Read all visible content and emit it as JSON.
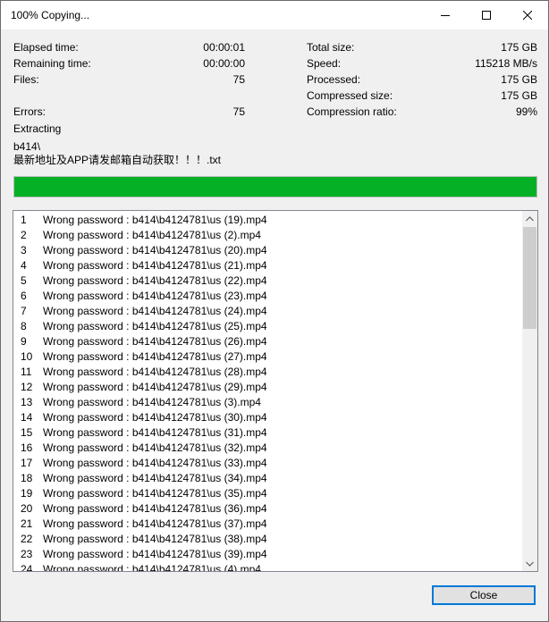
{
  "window": {
    "title": "100% Copying..."
  },
  "stats": {
    "elapsed_label": "Elapsed time:",
    "elapsed_value": "00:00:01",
    "remaining_label": "Remaining time:",
    "remaining_value": "00:00:00",
    "files_label": "Files:",
    "files_value": "75",
    "errors_label": "Errors:",
    "errors_value": "75",
    "total_size_label": "Total size:",
    "total_size_value": "175 GB",
    "speed_label": "Speed:",
    "speed_value": "115218 MB/s",
    "processed_label": "Processed:",
    "processed_value": "175 GB",
    "compressed_label": "Compressed size:",
    "compressed_value": "175 GB",
    "ratio_label": "Compression ratio:",
    "ratio_value": "99%"
  },
  "operation": "Extracting",
  "current_path": "b414\\",
  "current_file": "最新地址及APP请发邮箱自动获取！！！.txt",
  "progress_fraction": 1.0,
  "colors": {
    "progress": "#06b025",
    "accent": "#0078d7"
  },
  "log": [
    {
      "n": "1",
      "msg": "Wrong password : b414\\b4124781\\us (19).mp4"
    },
    {
      "n": "2",
      "msg": "Wrong password : b414\\b4124781\\us (2).mp4"
    },
    {
      "n": "3",
      "msg": "Wrong password : b414\\b4124781\\us (20).mp4"
    },
    {
      "n": "4",
      "msg": "Wrong password : b414\\b4124781\\us (21).mp4"
    },
    {
      "n": "5",
      "msg": "Wrong password : b414\\b4124781\\us (22).mp4"
    },
    {
      "n": "6",
      "msg": "Wrong password : b414\\b4124781\\us (23).mp4"
    },
    {
      "n": "7",
      "msg": "Wrong password : b414\\b4124781\\us (24).mp4"
    },
    {
      "n": "8",
      "msg": "Wrong password : b414\\b4124781\\us (25).mp4"
    },
    {
      "n": "9",
      "msg": "Wrong password : b414\\b4124781\\us (26).mp4"
    },
    {
      "n": "10",
      "msg": "Wrong password : b414\\b4124781\\us (27).mp4"
    },
    {
      "n": "11",
      "msg": "Wrong password : b414\\b4124781\\us (28).mp4"
    },
    {
      "n": "12",
      "msg": "Wrong password : b414\\b4124781\\us (29).mp4"
    },
    {
      "n": "13",
      "msg": "Wrong password : b414\\b4124781\\us (3).mp4"
    },
    {
      "n": "14",
      "msg": "Wrong password : b414\\b4124781\\us (30).mp4"
    },
    {
      "n": "15",
      "msg": "Wrong password : b414\\b4124781\\us (31).mp4"
    },
    {
      "n": "16",
      "msg": "Wrong password : b414\\b4124781\\us (32).mp4"
    },
    {
      "n": "17",
      "msg": "Wrong password : b414\\b4124781\\us (33).mp4"
    },
    {
      "n": "18",
      "msg": "Wrong password : b414\\b4124781\\us (34).mp4"
    },
    {
      "n": "19",
      "msg": "Wrong password : b414\\b4124781\\us (35).mp4"
    },
    {
      "n": "20",
      "msg": "Wrong password : b414\\b4124781\\us (36).mp4"
    },
    {
      "n": "21",
      "msg": "Wrong password : b414\\b4124781\\us (37).mp4"
    },
    {
      "n": "22",
      "msg": "Wrong password : b414\\b4124781\\us (38).mp4"
    },
    {
      "n": "23",
      "msg": "Wrong password : b414\\b4124781\\us (39).mp4"
    },
    {
      "n": "24",
      "msg": "Wrong password : b414\\b4124781\\us (4).mp4"
    }
  ],
  "buttons": {
    "close": "Close"
  }
}
